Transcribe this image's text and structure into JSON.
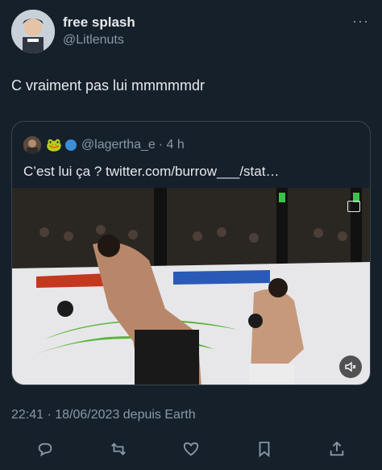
{
  "author": {
    "display_name": "free splash",
    "handle": "@Litlenuts",
    "more_label": "···"
  },
  "tweet": {
    "text": "C vraiment pas lui mmmmmdr"
  },
  "quote": {
    "name": "🐸",
    "handle": "@lagertha_e",
    "time": "· 4 h",
    "text": "C’est lui ça ? twitter.com/burrow___/stat…",
    "media_kind": "GIF"
  },
  "footer": {
    "timestamp": "22:41 · 18/06/2023 depuis Earth"
  },
  "actions": [
    {
      "name": "reply-icon"
    },
    {
      "name": "retweet-icon"
    },
    {
      "name": "like-icon"
    },
    {
      "name": "bookmark-icon"
    },
    {
      "name": "share-icon"
    }
  ],
  "colors": {
    "background": "#15202b",
    "text": "#e7e9ea",
    "muted": "#8b98a5",
    "border": "#38444d"
  }
}
